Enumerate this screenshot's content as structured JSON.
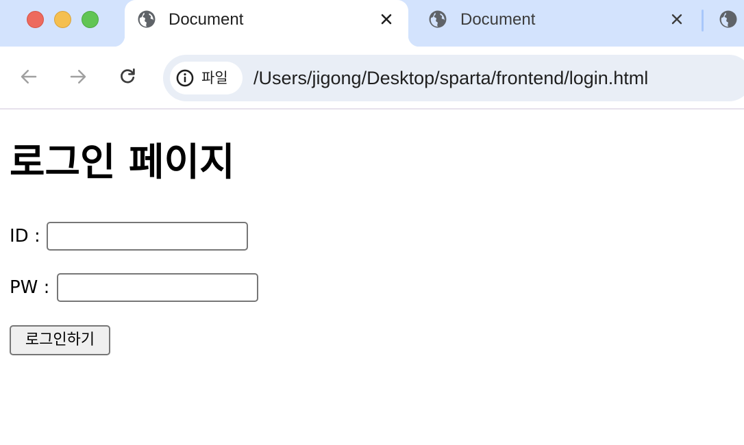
{
  "browser": {
    "tabs": [
      {
        "title": "Document",
        "active": true,
        "favicon": "globe-icon"
      },
      {
        "title": "Document",
        "active": false,
        "favicon": "globe-icon"
      }
    ],
    "traffic_lights": {
      "close_color": "#ed6a5e",
      "minimize_color": "#f5bf4f",
      "maximize_color": "#61c554"
    },
    "omnibox": {
      "chip_label": "파일",
      "chip_icon": "info-icon",
      "url": "/Users/jigong/Desktop/sparta/frontend/login.html"
    },
    "colors": {
      "tabstrip": "#d3e3fd",
      "omnibox": "#e9eef6"
    }
  },
  "page": {
    "title": "로그인 페이지",
    "id_label": "ID :",
    "id_value": "",
    "pw_label": "PW :",
    "pw_value": "",
    "login_button": "로그인하기"
  }
}
